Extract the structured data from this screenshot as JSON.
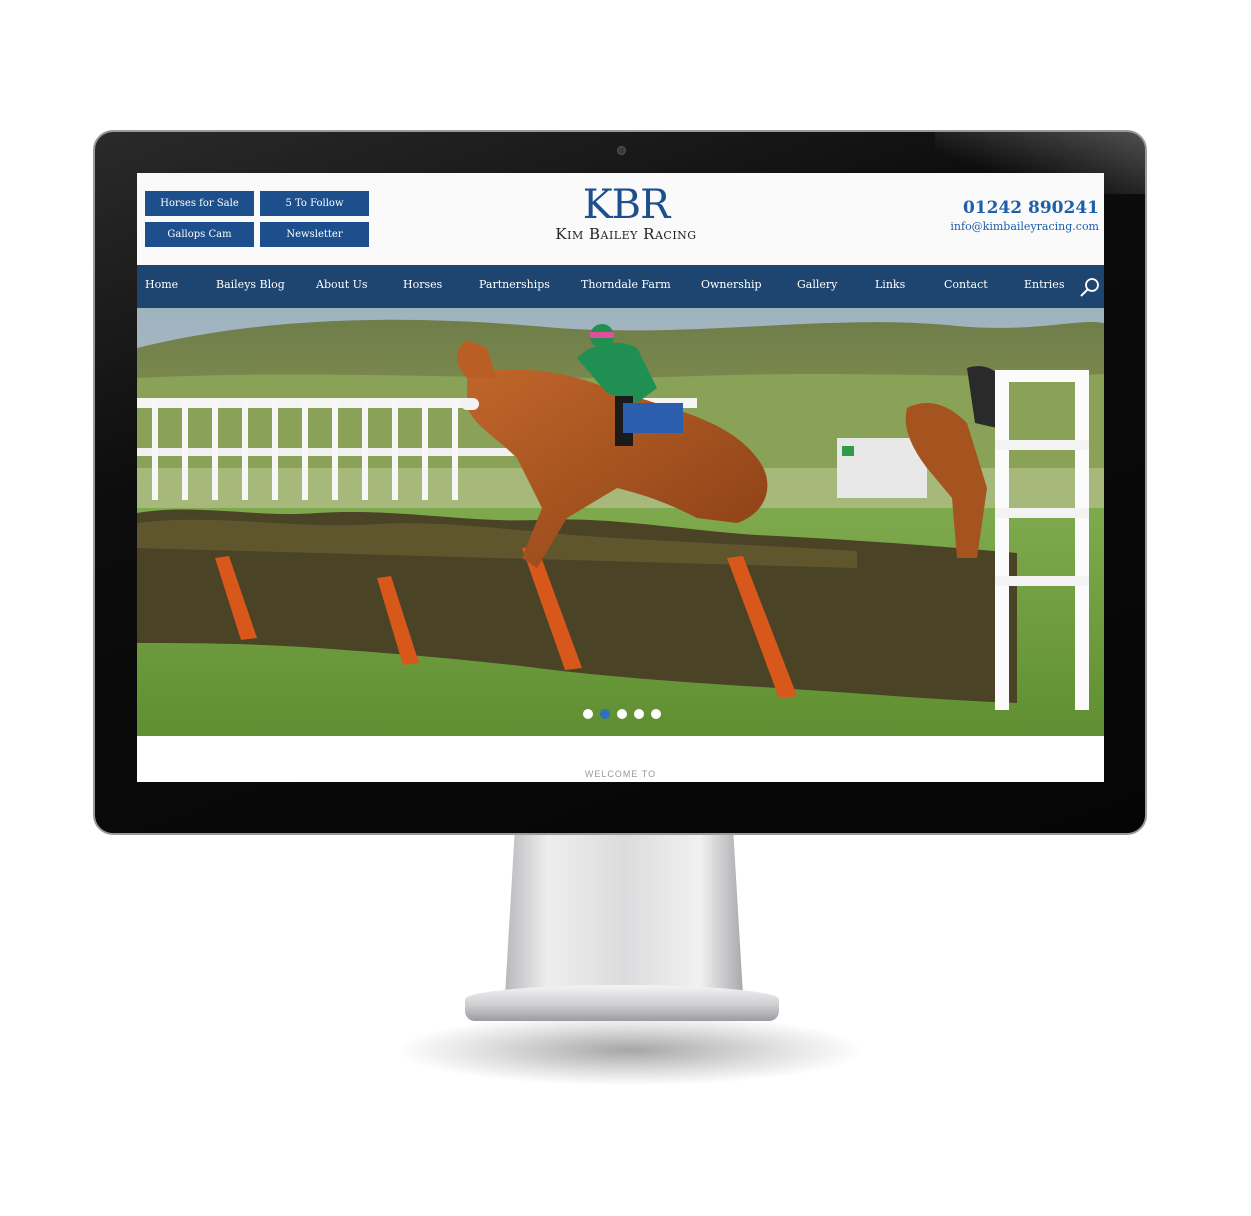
{
  "header": {
    "buttons": [
      "Horses for Sale",
      "5 To Follow",
      "Gallops Cam",
      "Newsletter"
    ],
    "logo_mark": "KBR",
    "logo_name": "Kim Bailey Racing",
    "phone": "01242 890241",
    "email": "info@kimbaileyracing.com"
  },
  "nav": {
    "items": [
      "Home",
      "Baileys Blog",
      "About Us",
      "Horses",
      "Partnerships",
      "Thorndale Farm",
      "Ownership",
      "Gallery",
      "Links",
      "Contact",
      "Entries"
    ],
    "search_icon": "search-icon"
  },
  "hero": {
    "slide_count": 5,
    "active_slide": 2
  },
  "welcome": {
    "text": "WELCOME TO"
  },
  "colors": {
    "brand_blue": "#1d4f8c",
    "nav_bg": "#1e4470",
    "link_blue": "#1d5fa8"
  }
}
